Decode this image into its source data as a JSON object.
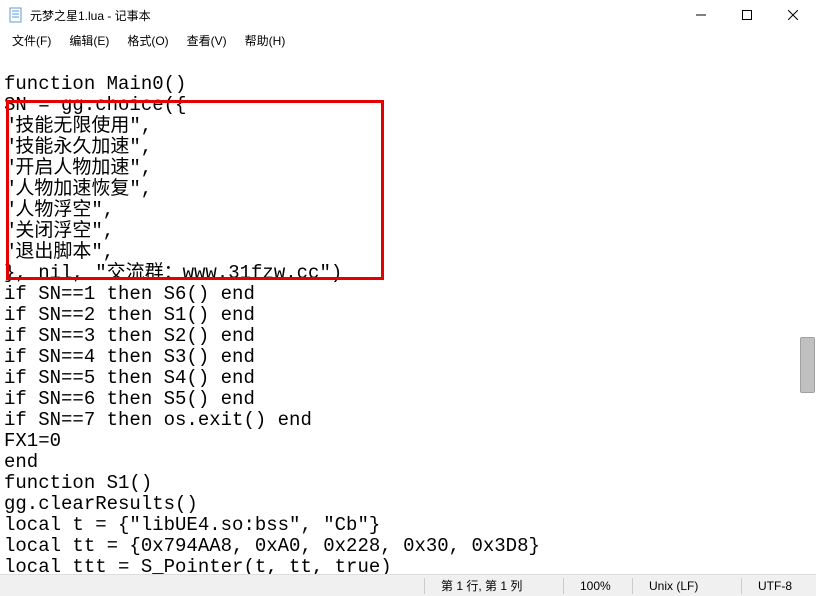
{
  "window": {
    "title": "元梦之星1.lua - 记事本"
  },
  "menu": {
    "file": "文件(F)",
    "edit": "编辑(E)",
    "format": "格式(O)",
    "view": "查看(V)",
    "help": "帮助(H)"
  },
  "code": {
    "text": "\nfunction Main0()\nSN = gg.choice({\n\"技能无限使用\",\n\"技能永久加速\",\n\"开启人物加速\",\n\"人物加速恢复\",\n\"人物浮空\",\n\"关闭浮空\",\n\"退出脚本\",\n}, nil, \"交流群：www.31fzw.cc\")\nif SN==1 then S6() end\nif SN==2 then S1() end\nif SN==3 then S2() end\nif SN==4 then S3() end\nif SN==5 then S4() end\nif SN==6 then S5() end\nif SN==7 then os.exit() end\nFX1=0\nend\nfunction S1()\ngg.clearResults()\nlocal t = {\"libUE4.so:bss\", \"Cb\"}\nlocal tt = {0x794AA8, 0xA0, 0x228, 0x30, 0x3D8}\nlocal ttt = S_Pointer(t, tt, true)"
  },
  "status": {
    "position": "第 1 行, 第 1 列",
    "zoom": "100%",
    "lineend": "Unix (LF)",
    "encoding": "UTF-8"
  }
}
